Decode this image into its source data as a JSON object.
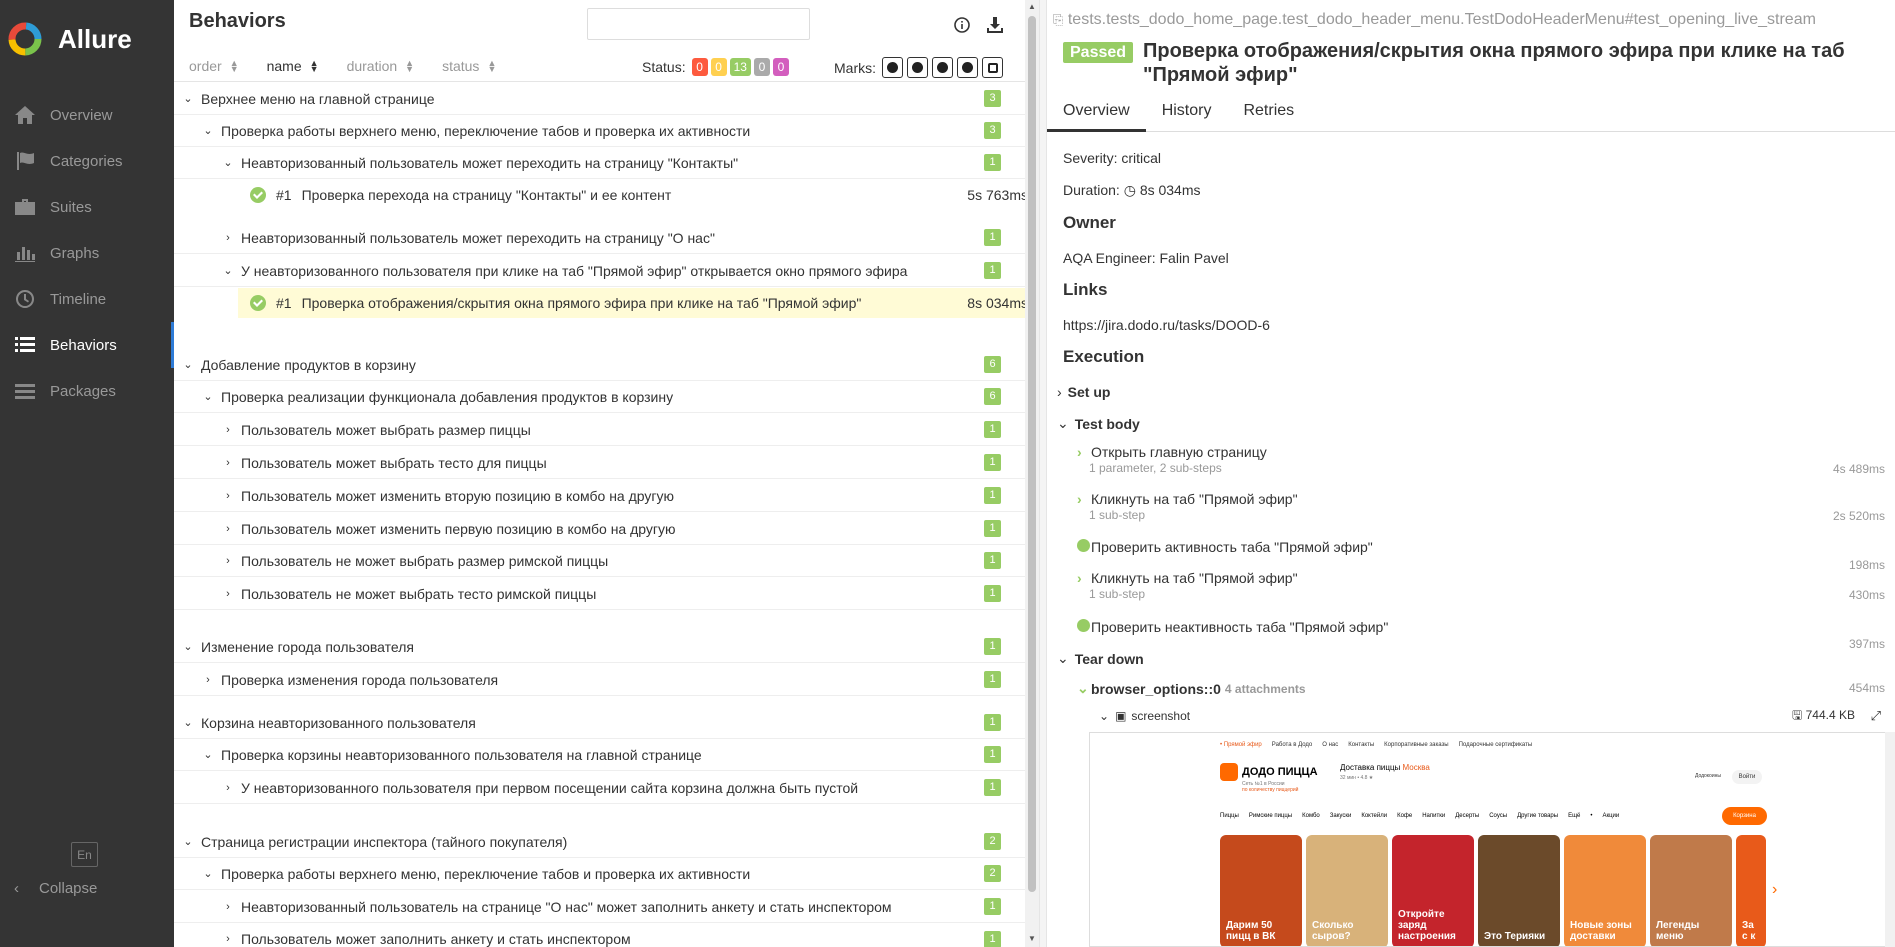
{
  "sidebar": {
    "brand": "Allure",
    "items": [
      {
        "label": "Overview",
        "icon": "home-icon"
      },
      {
        "label": "Categories",
        "icon": "flag-icon"
      },
      {
        "label": "Suites",
        "icon": "briefcase-icon"
      },
      {
        "label": "Graphs",
        "icon": "bar-chart-icon"
      },
      {
        "label": "Timeline",
        "icon": "clock-icon"
      },
      {
        "label": "Behaviors",
        "icon": "list-icon"
      },
      {
        "label": "Packages",
        "icon": "packages-icon"
      }
    ],
    "active": "Behaviors",
    "lang": "En",
    "collapse": "Collapse"
  },
  "behaviors": {
    "title": "Behaviors",
    "search_value": "",
    "sorters": [
      "order",
      "name",
      "duration",
      "status"
    ],
    "active_sorter": "name",
    "status_label": "Status:",
    "status_counts": [
      {
        "value": "0",
        "color": "#fd5a3e"
      },
      {
        "value": "0",
        "color": "#ffd050"
      },
      {
        "value": "13",
        "color": "#97cc64"
      },
      {
        "value": "0",
        "color": "#aaaaaa"
      },
      {
        "value": "0",
        "color": "#d35ebe"
      }
    ],
    "marks_label": "Marks:",
    "tree": [
      {
        "level": 0,
        "kind": "group",
        "expanded": true,
        "label": "Верхнее меню на главной странице",
        "count": "3"
      },
      {
        "level": 1,
        "kind": "group",
        "expanded": true,
        "label": "Проверка работы верхнего меню, переключение табов и проверка их активности",
        "count": "3"
      },
      {
        "level": 2,
        "kind": "group",
        "expanded": true,
        "label": "Неавторизованный пользователь может переходить на страницу \"Контакты\"",
        "count": "1"
      },
      {
        "level": 3,
        "kind": "case",
        "num": "#1",
        "label": "Проверка перехода на страницу \"Контакты\" и ее контент",
        "duration": "5s 763ms"
      },
      {
        "level": 2,
        "kind": "group",
        "expanded": false,
        "label": "Неавторизованный пользователь может переходить на страницу \"О нас\"",
        "count": "1"
      },
      {
        "level": 2,
        "kind": "group",
        "expanded": true,
        "label": "У неавторизованного пользователя при клике на таб \"Прямой эфир\" открывается окно прямого эфира",
        "count": "1"
      },
      {
        "level": 3,
        "kind": "case",
        "num": "#1",
        "label": "Проверка отображения/скрытия окна прямого эфира при клике на таб \"Прямой эфир\"",
        "duration": "8s 034ms",
        "selected": true
      },
      {
        "level": 0,
        "kind": "group",
        "expanded": true,
        "label": "Добавление продуктов в корзину",
        "count": "6"
      },
      {
        "level": 1,
        "kind": "group",
        "expanded": true,
        "label": "Проверка реализации функционала добавления продуктов в корзину",
        "count": "6"
      },
      {
        "level": 2,
        "kind": "group",
        "expanded": false,
        "label": "Пользователь может выбрать размер пиццы",
        "count": "1"
      },
      {
        "level": 2,
        "kind": "group",
        "expanded": false,
        "label": "Пользователь может выбрать тесто для пиццы",
        "count": "1"
      },
      {
        "level": 2,
        "kind": "group",
        "expanded": false,
        "label": "Пользователь может изменить вторую позицию в комбо на другую",
        "count": "1"
      },
      {
        "level": 2,
        "kind": "group",
        "expanded": false,
        "label": "Пользователь может изменить первую позицию в комбо на другую",
        "count": "1"
      },
      {
        "level": 2,
        "kind": "group",
        "expanded": false,
        "label": "Пользователь не может выбрать размер римской пиццы",
        "count": "1"
      },
      {
        "level": 2,
        "kind": "group",
        "expanded": false,
        "label": "Пользователь не может выбрать тесто римской пиццы",
        "count": "1"
      },
      {
        "level": 0,
        "kind": "group",
        "expanded": true,
        "label": "Изменение города пользователя",
        "count": "1"
      },
      {
        "level": 1,
        "kind": "group",
        "expanded": false,
        "label": "Проверка изменения города пользователя",
        "count": "1"
      },
      {
        "level": 0,
        "kind": "group",
        "expanded": true,
        "label": "Корзина неавторизованного пользователя",
        "count": "1"
      },
      {
        "level": 1,
        "kind": "group",
        "expanded": true,
        "label": "Проверка корзины неавторизованного пользователя на главной странице",
        "count": "1"
      },
      {
        "level": 2,
        "kind": "group",
        "expanded": false,
        "label": "У неавторизованного пользователя при первом посещении сайта корзина должна быть пустой",
        "count": "1"
      },
      {
        "level": 0,
        "kind": "group",
        "expanded": true,
        "label": "Страница регистрации инспектора (тайного покупателя)",
        "count": "2"
      },
      {
        "level": 1,
        "kind": "group",
        "expanded": true,
        "label": "Проверка работы верхнего меню, переключение табов и проверка их активности",
        "count": "2"
      },
      {
        "level": 2,
        "kind": "group",
        "expanded": false,
        "label": "Неавторизованный пользователь на странице \"О нас\" может заполнить анкету и стать инспектором",
        "count": "1"
      },
      {
        "level": 2,
        "kind": "group",
        "expanded": false,
        "label": "Пользователь может заполнить анкету и стать инспектором",
        "count": "1"
      }
    ]
  },
  "testcase": {
    "full_name": "tests.tests_dodo_home_page.test_dodo_header_menu.TestDodoHeaderMenu#test_opening_live_stream",
    "status": "Passed",
    "title": "Проверка отображения/скрытия окна прямого эфира при клике на таб \"Прямой эфир\"",
    "tabs": [
      "Overview",
      "History",
      "Retries"
    ],
    "active_tab": "Overview",
    "severity": "Severity: critical",
    "duration_label": "Duration:",
    "duration": "8s 034ms",
    "owner_title": "Owner",
    "owner": "AQA Engineer: Falin Pavel",
    "links_title": "Links",
    "link": "https://jira.dodo.ru/tasks/DOOD-6",
    "execution_title": "Execution",
    "setup": "Set up",
    "test_body": "Test body",
    "steps": [
      {
        "name": "Открыть главную страницу",
        "sub": "1 parameter, 2 sub-steps",
        "duration": "4s 489ms",
        "type": "expand"
      },
      {
        "name": "Кликнуть на таб \"Прямой эфир\"",
        "sub": "1 sub-step",
        "duration": "2s 520ms",
        "type": "expand"
      },
      {
        "name": "Проверить активность таба \"Прямой эфир\"",
        "sub": "",
        "duration": "198ms",
        "type": "ok"
      },
      {
        "name": "Кликнуть на таб \"Прямой эфир\"",
        "sub": "1 sub-step",
        "duration": "430ms",
        "type": "expand"
      },
      {
        "name": "Проверить неактивность таба \"Прямой эфир\"",
        "sub": "",
        "duration": "397ms",
        "type": "ok"
      }
    ],
    "teardown": "Tear down",
    "fixture": {
      "name": "browser_options::0",
      "sub": "4 attachments",
      "duration": "454ms"
    },
    "attachment": {
      "name": "screenshot",
      "size": "744.4 KB"
    }
  },
  "screenshot": {
    "topbar": [
      "• Прямой эфир",
      "Работа в Додо",
      "О нас",
      "Контакты",
      "Корпоративные заказы",
      "Подарочные сертификаты"
    ],
    "logo": "ДОДО ПИЦЦА",
    "slogan": "Сеть №1 в России",
    "slogan2": "по количеству пиццерий",
    "delivery": "Доставка пиццы",
    "city": "Москва",
    "rating": "32 мин • 4.8 ★",
    "dodo": "Додокоины",
    "login": "Войти",
    "menu": [
      "Пиццы",
      "Римские пиццы",
      "Комбо",
      "Закуски",
      "Коктейли",
      "Кофе",
      "Напитки",
      "Десерты",
      "Соусы",
      "Другие товары",
      "Ещё",
      "•",
      "Акции"
    ],
    "cart": "Корзина",
    "cards": [
      {
        "label": "Дарим 50 пицц в ВК",
        "color": "#c54a1c"
      },
      {
        "label": "Сколько сыров?",
        "color": "#d8b27a"
      },
      {
        "label": "Откройте заряд настроения",
        "color": "#c4242c"
      },
      {
        "label": "Это Терияки",
        "color": "#6b4a2a"
      },
      {
        "label": "Новые зоны доставки",
        "color": "#f08a3a"
      },
      {
        "label": "Легенды меню",
        "color": "#c07a4a"
      },
      {
        "label": "За с к",
        "color": "#e85a1a"
      }
    ]
  }
}
